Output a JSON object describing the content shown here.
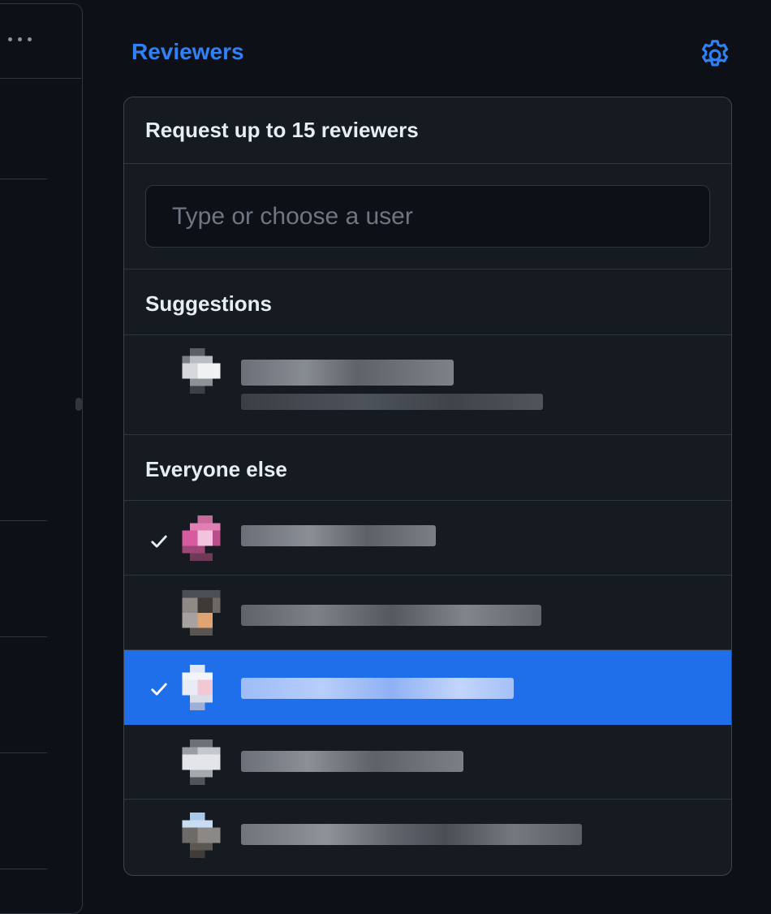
{
  "sidebar_title": "Reviewers",
  "icons": {
    "settings": "gear-icon",
    "more": "kebab-horizontal-icon",
    "check": "check-icon"
  },
  "colors": {
    "accent": "#2f81f7",
    "selected_row": "#1f6feb",
    "panel_bg": "#161b22",
    "page_bg": "#0d1117"
  },
  "dropdown": {
    "header": "Request up to 15 reviewers",
    "filter": {
      "placeholder": "Type or choose a user",
      "value": ""
    },
    "sections": {
      "suggestions": "Suggestions",
      "everyone_else": "Everyone else"
    },
    "suggestions": [
      {
        "checked": false,
        "selected": false
      }
    ],
    "everyone_else": [
      {
        "checked": true,
        "selected": false
      },
      {
        "checked": false,
        "selected": false
      },
      {
        "checked": true,
        "selected": true
      },
      {
        "checked": false,
        "selected": false
      },
      {
        "checked": false,
        "selected": false
      }
    ]
  }
}
